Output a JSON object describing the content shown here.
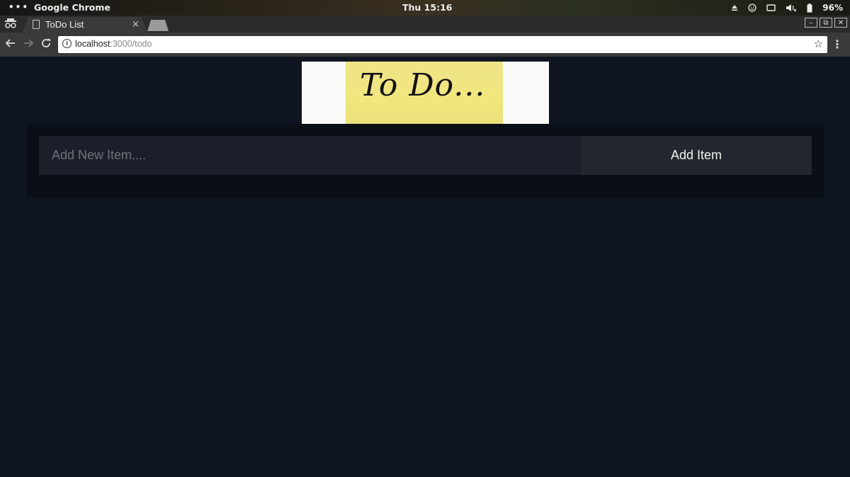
{
  "system_bar": {
    "activities_icon": "dots-icon",
    "app_name": "Google Chrome",
    "clock": "Thu 15:16",
    "battery_percent": "96%"
  },
  "browser": {
    "tab": {
      "title": "ToDo List",
      "close_glyph": "×"
    },
    "address": {
      "host": "localhost",
      "path": ":3000/todo"
    },
    "window_controls": [
      "–",
      "⧉",
      "✕"
    ]
  },
  "page": {
    "banner_text": "To Do...",
    "input": {
      "placeholder": "Add New Item....",
      "value": ""
    },
    "add_button_label": "Add Item"
  }
}
